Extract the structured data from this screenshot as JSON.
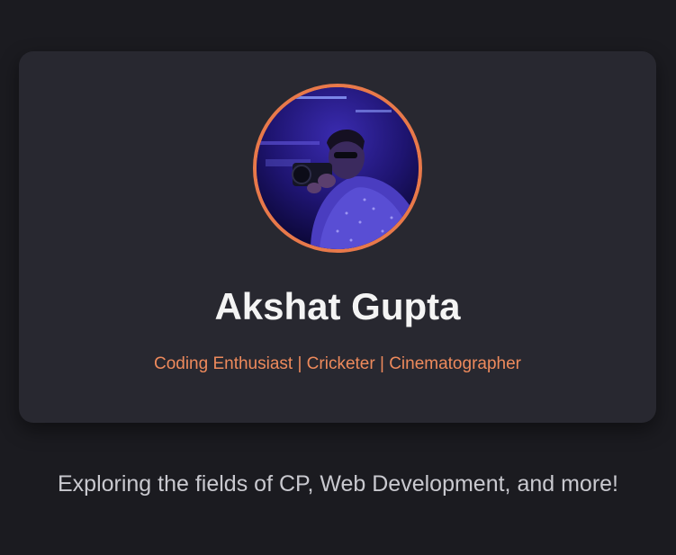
{
  "profile": {
    "name": "Akshat Gupta",
    "tagline": "Coding Enthusiast | Cricketer | Cinematographer",
    "avatar_icon": "profile-photo",
    "accent_color": "#e8794a"
  },
  "intro": {
    "text": "Exploring the fields of CP, Web Development, and more!"
  },
  "colors": {
    "background": "#1b1b20",
    "card": "#282830",
    "name": "#f4f4f4",
    "tagline": "#ee8a5c",
    "intro": "#c9c9cf"
  }
}
